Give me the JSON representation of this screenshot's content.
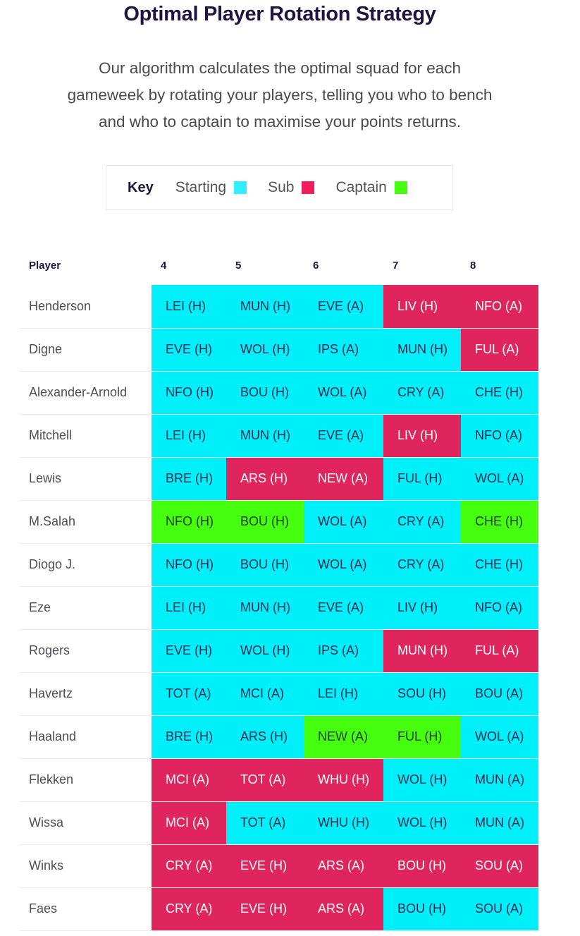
{
  "header": {
    "title": "Optimal Player Rotation Strategy",
    "intro_lines": [
      "Our algorithm calculates the optimal squad for each",
      "gameweek by rotating your players, telling you who to bench",
      "and who to captain to maximise your points returns."
    ]
  },
  "key": {
    "label": "Key",
    "items": [
      {
        "label": "Starting",
        "status": "starting",
        "color": "#2ef0ff"
      },
      {
        "label": "Sub",
        "status": "sub",
        "color": "#f01f5c"
      },
      {
        "label": "Captain",
        "status": "captain",
        "color": "#45ff0e"
      }
    ]
  },
  "colors": {
    "starting": "#00f0fa",
    "sub": "#e0245e",
    "captain": "#45ff0e"
  },
  "table": {
    "player_header": "Player",
    "gameweeks": [
      "4",
      "5",
      "6",
      "7",
      "8"
    ],
    "rows": [
      {
        "player": "Henderson",
        "fixtures": [
          {
            "text": "LEI (H)",
            "status": "starting"
          },
          {
            "text": "MUN (H)",
            "status": "starting"
          },
          {
            "text": "EVE (A)",
            "status": "starting"
          },
          {
            "text": "LIV (H)",
            "status": "sub"
          },
          {
            "text": "NFO (A)",
            "status": "sub"
          }
        ]
      },
      {
        "player": "Digne",
        "fixtures": [
          {
            "text": "EVE (H)",
            "status": "starting"
          },
          {
            "text": "WOL (H)",
            "status": "starting"
          },
          {
            "text": "IPS (A)",
            "status": "starting"
          },
          {
            "text": "MUN (H)",
            "status": "starting"
          },
          {
            "text": "FUL (A)",
            "status": "sub"
          }
        ]
      },
      {
        "player": "Alexander-Arnold",
        "fixtures": [
          {
            "text": "NFO (H)",
            "status": "starting"
          },
          {
            "text": "BOU (H)",
            "status": "starting"
          },
          {
            "text": "WOL (A)",
            "status": "starting"
          },
          {
            "text": "CRY (A)",
            "status": "starting"
          },
          {
            "text": "CHE (H)",
            "status": "starting"
          }
        ]
      },
      {
        "player": "Mitchell",
        "fixtures": [
          {
            "text": "LEI (H)",
            "status": "starting"
          },
          {
            "text": "MUN (H)",
            "status": "starting"
          },
          {
            "text": "EVE (A)",
            "status": "starting"
          },
          {
            "text": "LIV (H)",
            "status": "sub"
          },
          {
            "text": "NFO (A)",
            "status": "starting"
          }
        ]
      },
      {
        "player": "Lewis",
        "fixtures": [
          {
            "text": "BRE (H)",
            "status": "starting"
          },
          {
            "text": "ARS (H)",
            "status": "sub"
          },
          {
            "text": "NEW (A)",
            "status": "sub"
          },
          {
            "text": "FUL (H)",
            "status": "starting"
          },
          {
            "text": "WOL (A)",
            "status": "starting"
          }
        ]
      },
      {
        "player": "M.Salah",
        "fixtures": [
          {
            "text": "NFO (H)",
            "status": "captain"
          },
          {
            "text": "BOU (H)",
            "status": "captain"
          },
          {
            "text": "WOL (A)",
            "status": "starting"
          },
          {
            "text": "CRY (A)",
            "status": "starting"
          },
          {
            "text": "CHE (H)",
            "status": "captain"
          }
        ]
      },
      {
        "player": "Diogo J.",
        "fixtures": [
          {
            "text": "NFO (H)",
            "status": "starting"
          },
          {
            "text": "BOU (H)",
            "status": "starting"
          },
          {
            "text": "WOL (A)",
            "status": "starting"
          },
          {
            "text": "CRY (A)",
            "status": "starting"
          },
          {
            "text": "CHE (H)",
            "status": "starting"
          }
        ]
      },
      {
        "player": "Eze",
        "fixtures": [
          {
            "text": "LEI (H)",
            "status": "starting"
          },
          {
            "text": "MUN (H)",
            "status": "starting"
          },
          {
            "text": "EVE (A)",
            "status": "starting"
          },
          {
            "text": "LIV (H)",
            "status": "starting"
          },
          {
            "text": "NFO (A)",
            "status": "starting"
          }
        ]
      },
      {
        "player": "Rogers",
        "fixtures": [
          {
            "text": "EVE (H)",
            "status": "starting"
          },
          {
            "text": "WOL (H)",
            "status": "starting"
          },
          {
            "text": "IPS (A)",
            "status": "starting"
          },
          {
            "text": "MUN (H)",
            "status": "sub"
          },
          {
            "text": "FUL (A)",
            "status": "sub"
          }
        ]
      },
      {
        "player": "Havertz",
        "fixtures": [
          {
            "text": "TOT (A)",
            "status": "starting"
          },
          {
            "text": "MCI (A)",
            "status": "starting"
          },
          {
            "text": "LEI (H)",
            "status": "starting"
          },
          {
            "text": "SOU (H)",
            "status": "starting"
          },
          {
            "text": "BOU (A)",
            "status": "starting"
          }
        ]
      },
      {
        "player": "Haaland",
        "fixtures": [
          {
            "text": "BRE (H)",
            "status": "starting"
          },
          {
            "text": "ARS (H)",
            "status": "starting"
          },
          {
            "text": "NEW (A)",
            "status": "captain"
          },
          {
            "text": "FUL (H)",
            "status": "captain"
          },
          {
            "text": "WOL (A)",
            "status": "starting"
          }
        ]
      },
      {
        "player": "Flekken",
        "fixtures": [
          {
            "text": "MCI (A)",
            "status": "sub"
          },
          {
            "text": "TOT (A)",
            "status": "sub"
          },
          {
            "text": "WHU (H)",
            "status": "sub"
          },
          {
            "text": "WOL (H)",
            "status": "starting"
          },
          {
            "text": "MUN (A)",
            "status": "starting"
          }
        ]
      },
      {
        "player": "Wissa",
        "fixtures": [
          {
            "text": "MCI (A)",
            "status": "sub"
          },
          {
            "text": "TOT (A)",
            "status": "starting"
          },
          {
            "text": "WHU (H)",
            "status": "starting"
          },
          {
            "text": "WOL (H)",
            "status": "starting"
          },
          {
            "text": "MUN (A)",
            "status": "starting"
          }
        ]
      },
      {
        "player": "Winks",
        "fixtures": [
          {
            "text": "CRY (A)",
            "status": "sub"
          },
          {
            "text": "EVE (H)",
            "status": "sub"
          },
          {
            "text": "ARS (A)",
            "status": "sub"
          },
          {
            "text": "BOU (H)",
            "status": "sub"
          },
          {
            "text": "SOU (A)",
            "status": "sub"
          }
        ]
      },
      {
        "player": "Faes",
        "fixtures": [
          {
            "text": "CRY (A)",
            "status": "sub"
          },
          {
            "text": "EVE (H)",
            "status": "sub"
          },
          {
            "text": "ARS (A)",
            "status": "sub"
          },
          {
            "text": "BOU (H)",
            "status": "starting"
          },
          {
            "text": "SOU (A)",
            "status": "starting"
          }
        ]
      }
    ]
  }
}
